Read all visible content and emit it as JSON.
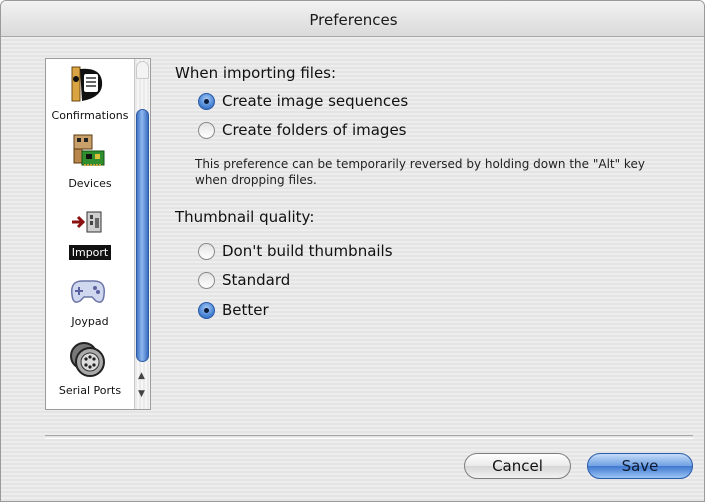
{
  "window": {
    "title": "Preferences"
  },
  "sidebar": {
    "items": [
      {
        "label": "Confirmations",
        "icon": "confirmations-icon"
      },
      {
        "label": "Devices",
        "icon": "devices-icon"
      },
      {
        "label": "Import",
        "icon": "import-icon",
        "selected": true
      },
      {
        "label": "Joypad",
        "icon": "joypad-icon"
      },
      {
        "label": "Serial Ports",
        "icon": "serial-ports-icon"
      }
    ]
  },
  "import_section": {
    "heading": "When importing files:",
    "options": [
      {
        "label": "Create image sequences",
        "selected": true
      },
      {
        "label": "Create folders of images",
        "selected": false
      }
    ],
    "note_line1": "This preference can be temporarily reversed by holding down the \"Alt\" key",
    "note_line2": "when dropping files."
  },
  "thumbnail_section": {
    "heading": "Thumbnail quality:",
    "options": [
      {
        "label": "Don't build thumbnails",
        "selected": false
      },
      {
        "label": "Standard",
        "selected": false
      },
      {
        "label": "Better",
        "selected": true
      }
    ]
  },
  "buttons": {
    "cancel": "Cancel",
    "save": "Save"
  },
  "colors": {
    "accent": "#3f78cf",
    "selected_label_bg": "#111111"
  }
}
